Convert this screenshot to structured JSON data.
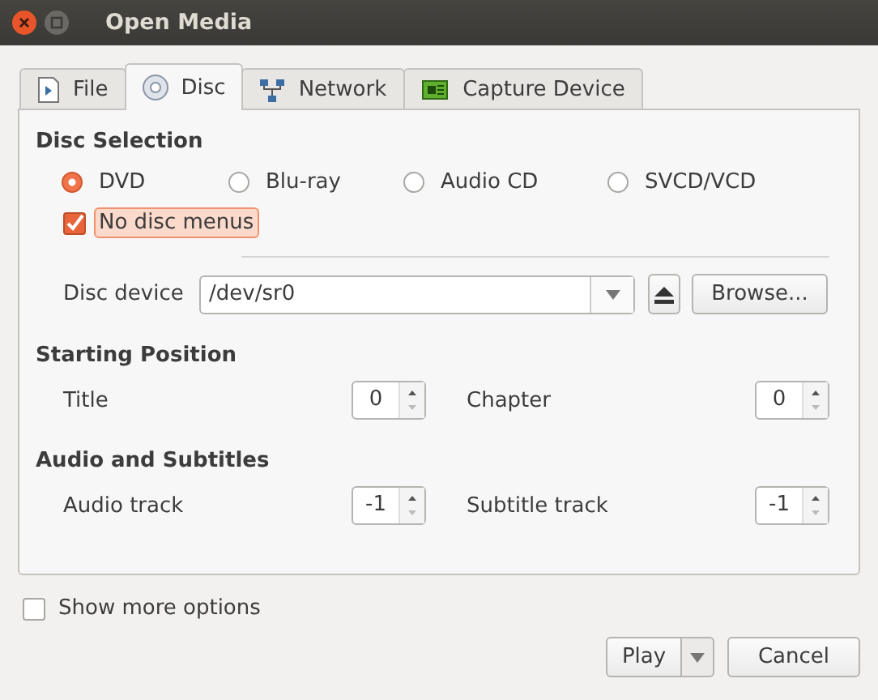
{
  "window": {
    "title": "Open Media"
  },
  "tabs": [
    {
      "label": "File",
      "kind": "file",
      "selected": false
    },
    {
      "label": "Disc",
      "kind": "disc",
      "selected": true
    },
    {
      "label": "Network",
      "kind": "network",
      "selected": false
    },
    {
      "label": "Capture Device",
      "kind": "capture",
      "selected": false
    }
  ],
  "disc_selection": {
    "heading": "Disc Selection",
    "types": [
      {
        "label": "DVD",
        "selected": true
      },
      {
        "label": "Blu-ray",
        "selected": false
      },
      {
        "label": "Audio CD",
        "selected": false
      },
      {
        "label": "SVCD/VCD",
        "selected": false
      }
    ],
    "no_disc_menus": {
      "label": "No disc menus",
      "checked": true
    },
    "disc_device": {
      "label": "Disc device",
      "value": "/dev/sr0"
    },
    "browse_button": "Browse..."
  },
  "starting_position": {
    "heading": "Starting Position",
    "fields": [
      {
        "label": "Title",
        "value": "0"
      },
      {
        "label": "Chapter",
        "value": "0"
      }
    ]
  },
  "audio_subtitles": {
    "heading": "Audio and Subtitles",
    "fields": [
      {
        "label": "Audio track",
        "value": "-1"
      },
      {
        "label": "Subtitle track",
        "value": "-1"
      }
    ]
  },
  "show_more_options": {
    "label": "Show more options",
    "checked": false
  },
  "buttons": {
    "play": "Play",
    "cancel": "Cancel"
  }
}
